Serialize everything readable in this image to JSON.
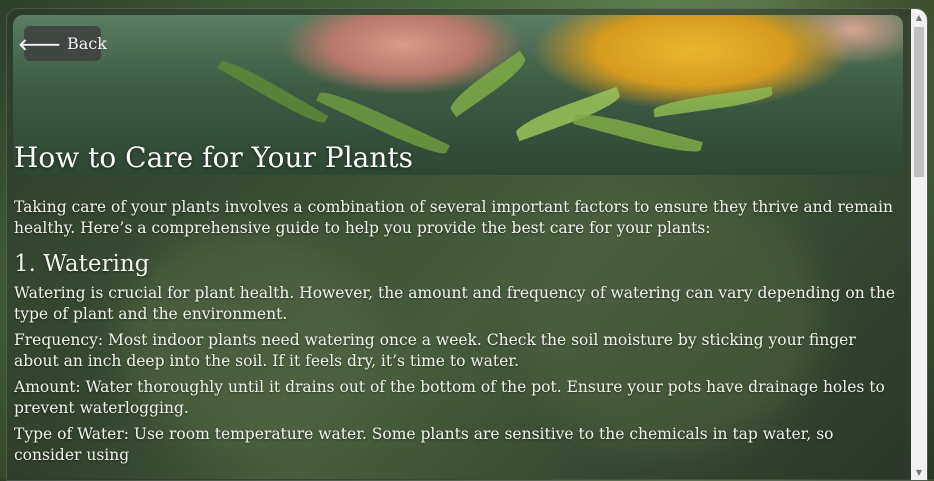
{
  "back_button": {
    "icon": "arrow-left-icon",
    "label": "Back"
  },
  "article": {
    "title": "How to Care for Your Plants",
    "intro": "Taking care of your plants involves a combination of several important factors to ensure they thrive and remain healthy. Here’s a comprehensive guide to help you provide the best care for your plants:",
    "sections": [
      {
        "heading": "1. Watering",
        "paragraphs": [
          "Watering is crucial for plant health. However, the amount and frequency of watering can vary depending on the type of plant and the environment.",
          "Frequency: Most indoor plants need watering once a week. Check the soil moisture by sticking your finger about an inch deep into the soil. If it feels dry, it’s time to water.",
          "Amount: Water thoroughly until it drains out of the bottom of the pot. Ensure your pots have drainage holes to prevent waterlogging.",
          "Type of Water: Use room temperature water. Some plants are sensitive to the chemicals in tap water, so consider using"
        ]
      }
    ]
  },
  "colors": {
    "overlay": "#2c362c",
    "text": "#f2f2ee",
    "button_bg": "#3c3c3c"
  }
}
